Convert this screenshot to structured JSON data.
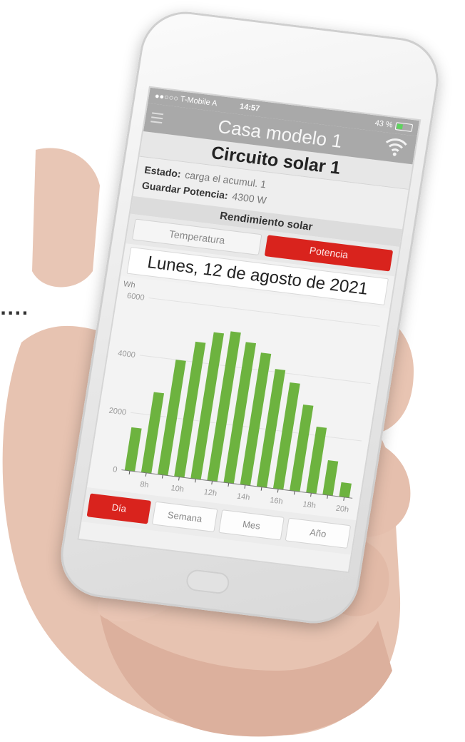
{
  "decoration": {
    "dots": "...."
  },
  "statusbar": {
    "carrier": "●●○○○ T-Mobile A",
    "time": "14:57",
    "battery": "43 %"
  },
  "navbar": {
    "title": "Casa modelo 1"
  },
  "circuit": {
    "title": "Circuito solar 1"
  },
  "info": {
    "estado_label": "Estado:",
    "estado_value": "carga el acumul. 1",
    "potencia_label": "Guardar Potencia:",
    "potencia_value": "4300 W"
  },
  "section": {
    "title": "Rendimiento solar"
  },
  "toggle": {
    "temperatura": "Temperatura",
    "potencia": "Potencia",
    "selected": "potencia"
  },
  "date": {
    "label": "Lunes, 12 de agosto de 2021"
  },
  "colors": {
    "accent": "#d9231d",
    "bar": "#6db33f",
    "header": "#a9a9a9"
  },
  "chart_data": {
    "type": "bar",
    "ylabel": "Wh",
    "ylim": [
      0,
      6000
    ],
    "y_ticks": [
      0,
      2000,
      4000,
      6000
    ],
    "x_tick_labels": [
      "8h",
      "10h",
      "12h",
      "14h",
      "16h",
      "18h",
      "20h"
    ],
    "categories": [
      "7h",
      "8h",
      "9h",
      "10h",
      "11h",
      "12h",
      "13h",
      "14h",
      "15h",
      "16h",
      "17h",
      "18h",
      "19h",
      "20h"
    ],
    "values": [
      1500,
      2800,
      4000,
      4700,
      5100,
      5200,
      4900,
      4600,
      4100,
      3700,
      3000,
      2300,
      1200,
      500
    ]
  },
  "bottom_tabs": {
    "dia": "Día",
    "semana": "Semana",
    "mes": "Mes",
    "ano": "Año",
    "selected": "dia"
  }
}
